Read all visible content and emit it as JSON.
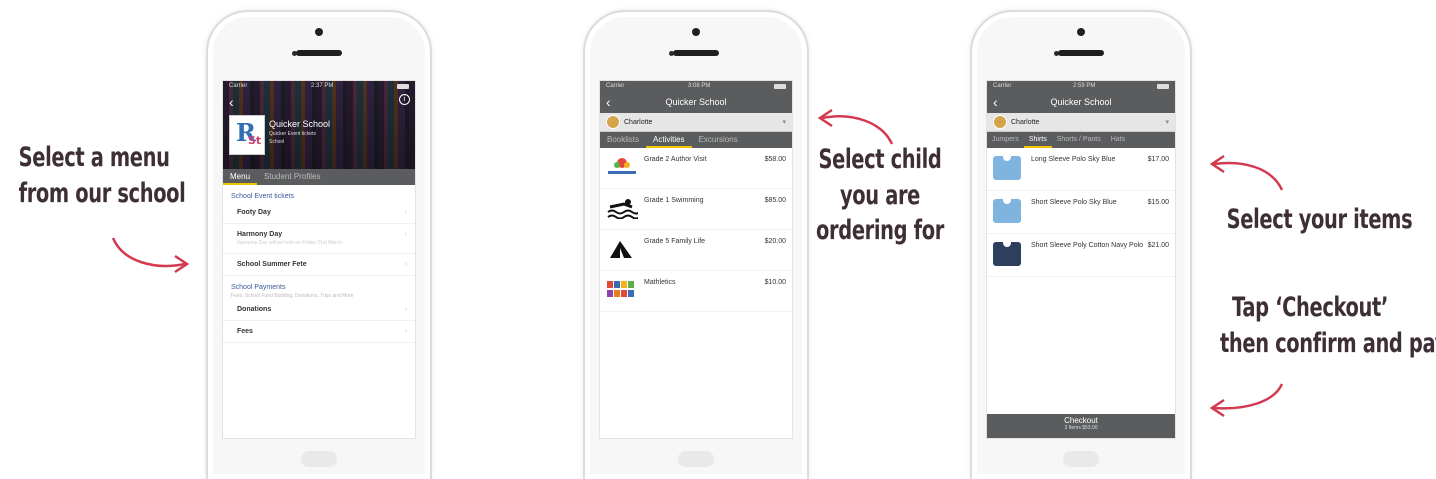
{
  "captions": {
    "left": [
      "Select a menu",
      "from our school"
    ],
    "middle": [
      "Select child",
      "you are",
      "ordering for"
    ],
    "right_top": [
      "Select your items"
    ],
    "right_bottom": [
      "Tap ‘Checkout’",
      "then confirm and pay"
    ]
  },
  "colors": {
    "accent": "#f2c400",
    "caption": "#3e2f37",
    "arrow": "#d23a50",
    "bar": "#5a5c5e"
  },
  "phone1": {
    "status": {
      "carrier": "Carrier",
      "time": "2:37 PM"
    },
    "school_name": "Quicker School",
    "school_sub": "Quicker Event tickets",
    "school_sub2": "School",
    "tabs": [
      "Menu",
      "Student Profiles"
    ],
    "section1": "School Event tickets",
    "items1": [
      {
        "label": "Footy Day",
        "sub": ""
      },
      {
        "label": "Harmony Day",
        "sub": "Harmony Day will be held on Friday 21st March"
      },
      {
        "label": "School Summer Fete",
        "sub": ""
      }
    ],
    "section2": "School Payments",
    "section2_sub": "Fees, School Fund Building, Donations, Trips and More",
    "items2": [
      {
        "label": "Donations"
      },
      {
        "label": "Fees"
      }
    ],
    "home_label": "Home"
  },
  "phone2": {
    "status": {
      "carrier": "Carrier",
      "time": "3:08 PM"
    },
    "title": "Quicker School",
    "child": "Charlotte",
    "tabs": [
      "Booklists",
      "Activities",
      "Excursions"
    ],
    "active_tab": "Activities",
    "products": [
      {
        "name": "Grade 2 Author Visit",
        "price": "$58.00",
        "icon": "children-logo-icon"
      },
      {
        "name": "Grade 1 Swimming",
        "price": "$85.00",
        "icon": "swimmer-icon"
      },
      {
        "name": "Grade 5 Family Life",
        "price": "$20.00",
        "icon": "tent-icon"
      },
      {
        "name": "Mathletics",
        "price": "$10.00",
        "icon": "numbers-icon"
      }
    ],
    "home_label": "Home"
  },
  "phone3": {
    "status": {
      "carrier": "Carrier",
      "time": "2:59 PM"
    },
    "title": "Quicker School",
    "child": "Charlotte",
    "tabs": [
      "Jumpers",
      "Shirts",
      "Shorts / Pants",
      "Hats"
    ],
    "active_tab": "Shirts",
    "products": [
      {
        "name": "Long Sleeve Polo Sky Blue",
        "price": "$17.00",
        "color": "#7fb3e0"
      },
      {
        "name": "Short Sleeve Polo Sky Blue",
        "price": "$15.00",
        "color": "#7fb3e0"
      },
      {
        "name": "Short Sleeve Poly Cotton Navy Polo",
        "price": "$21.00",
        "color": "#2e3f5d"
      }
    ],
    "checkout_label": "Checkout",
    "checkout_sub": "3 Items $53.00",
    "home_label": "Home"
  }
}
